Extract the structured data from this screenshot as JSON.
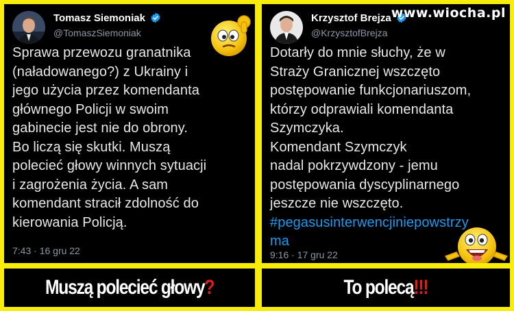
{
  "left_tweet": {
    "author_name": "Tomasz Siemoniak",
    "handle": "@TomaszSiemoniak",
    "verified": true,
    "avatar_icon": "person-photo",
    "lines": [
      "Sprawa przewozu granatnika",
      "(naładowanego?) z Ukrainy i",
      "jego użycia przez komendanta",
      "głównego Policji w swoim",
      "gabinecie jest nie do obrony.",
      "Bo liczą się skutki. Muszą",
      "polecieć głowy winnych sytuacji",
      "i zagrożenia życia. A sam",
      "komendant stracił zdolność do",
      "kierowania Policją."
    ],
    "timestamp": "7:43 · 16 gru 22",
    "emoji_icon": "thinking-face-emoji"
  },
  "right_tweet": {
    "author_name": "Krzysztof Brejza",
    "handle": "@KrzysztofBrejza",
    "verified": true,
    "avatar_icon": "person-photo",
    "lines": [
      "Dotarły do mnie słuchy, że w",
      "Straży Granicznej wszczęto",
      "postępowanie funkcjonariuszom,",
      "którzy odprawiali komendanta",
      "Szymczyka.",
      "Komendant Szymczyk",
      "nadal pokrzywdzony - jemu",
      "postępowania dyscyplinarnego",
      "jeszcze nie wszczęto."
    ],
    "hashtag_lines": [
      "#pegasusinterwencjiniepowstrzy",
      "ma"
    ],
    "timestamp": "9:16 · 17 gru 22",
    "emoji_icon": "laughing-pointing-emoji"
  },
  "watermark": "www.wiocha.pl",
  "captions": {
    "left_text": "Muszą polecieć głowy",
    "left_mark": "?",
    "right_text": "To polecą",
    "right_mark": "!!!"
  },
  "colors": {
    "background": "#f7ec0c",
    "panel": "#000000",
    "text": "#e7e9ea",
    "secondary_text": "#8b98a5",
    "hashtag": "#1d9bf0",
    "verified_badge": "#1d9bf0",
    "caption_mark": "#e31b1b"
  }
}
